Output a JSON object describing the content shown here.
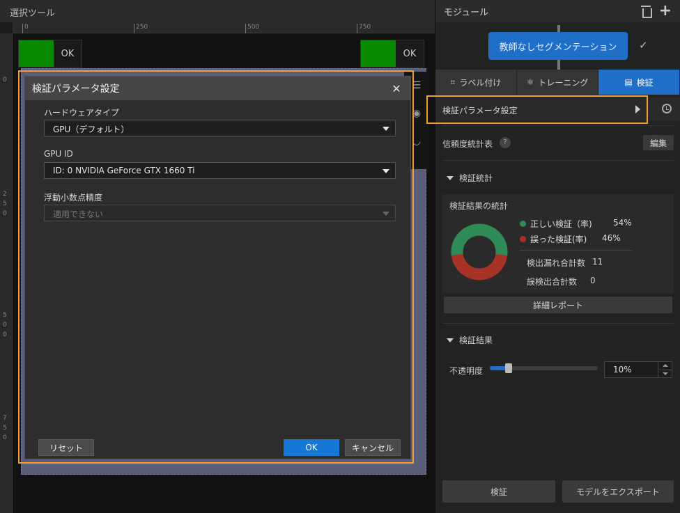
{
  "left": {
    "title": "選択ツール",
    "ruler_ticks": [
      "0",
      "250",
      "500",
      "750"
    ],
    "ruler_left_labels": [
      "0",
      "2",
      "5",
      "0",
      "5",
      "0",
      "0",
      "7",
      "5",
      "0"
    ],
    "ok_labels": [
      "OK",
      "OK"
    ]
  },
  "dialog": {
    "title": "検証パラメータ設定",
    "hardware_label": "ハードウェアタイプ",
    "hardware_value": "GPU（デフォルト）",
    "gpu_id_label": "GPU ID",
    "gpu_id_value": "ID: 0  NVIDIA GeForce GTX 1660 Ti",
    "precision_label": "浮動小数点精度",
    "precision_value": "適用できない",
    "reset_label": "リセット",
    "ok_label": "OK",
    "cancel_label": "キャンセル"
  },
  "right": {
    "title": "モジュール",
    "module_label": "教師なしセグメンテーション",
    "tabs": [
      {
        "label": "ラベル付け",
        "icon": "label-frame-icon"
      },
      {
        "label": "トレーニング",
        "icon": "network-icon"
      },
      {
        "label": "検証",
        "icon": "validation-icon"
      }
    ],
    "param_label": "検証パラメータ設定",
    "confidence_label": "信頼度統計表",
    "edit_label": "編集",
    "stats_section": "検証統計",
    "stats_title": "検証結果の統計",
    "correct_label": "正しい検証（率)",
    "correct_pct": "54%",
    "wrong_label": "誤った検証(率)",
    "wrong_pct": "46%",
    "miss_label": "検出漏れ合計数",
    "miss_value": "11",
    "false_label": "誤検出合計数",
    "false_value": "0",
    "report_label": "詳細レポート",
    "results_section": "検証結果",
    "opacity_label": "不透明度",
    "opacity_value": "10%",
    "opacity_level": 0.1,
    "validate_label": "検証",
    "export_label": "モデルをエクスポート"
  },
  "colors": {
    "accent": "#1f6fc8",
    "highlight": "#f4a030",
    "correct": "#2e8b57",
    "wrong": "#a83226",
    "ok_green": "#0a8a00"
  }
}
